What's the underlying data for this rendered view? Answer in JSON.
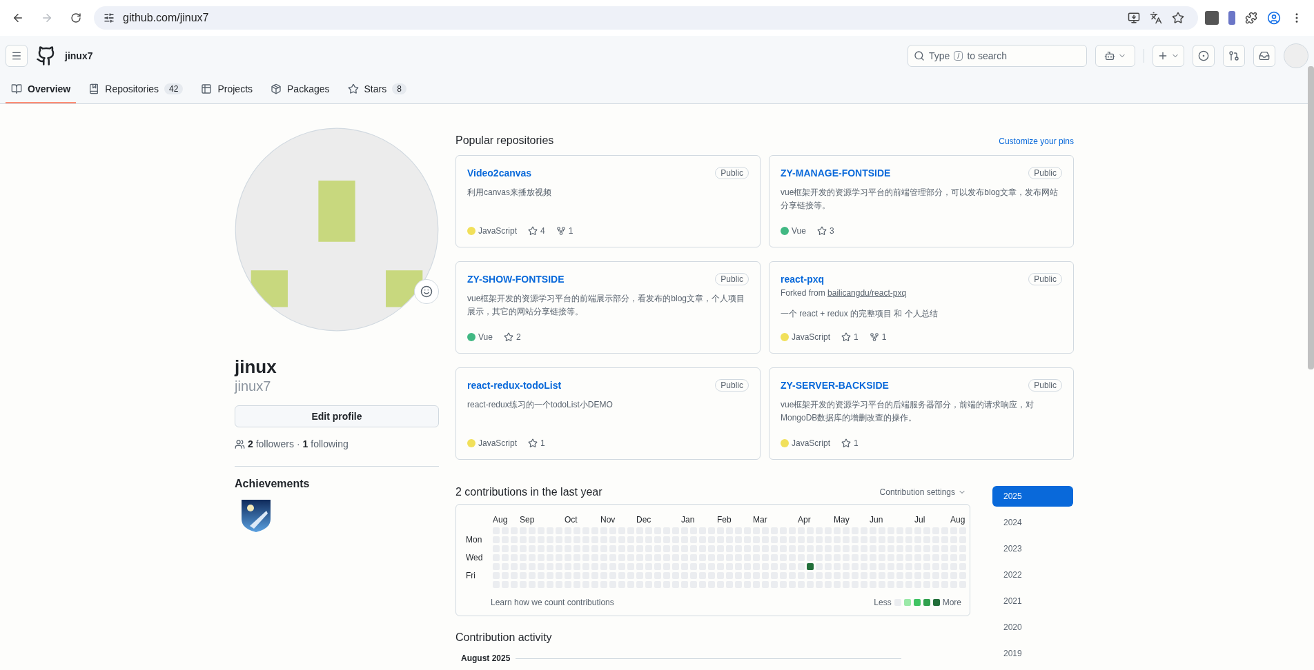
{
  "browser": {
    "url": "github.com/jinux7",
    "can_go_forward": false
  },
  "header": {
    "username": "jinux7",
    "search": {
      "prefix": "Type",
      "key": "/",
      "suffix": "to search"
    }
  },
  "tabs": [
    {
      "label": "Overview",
      "selected": true
    },
    {
      "label": "Repositories",
      "count": "42",
      "selected": false
    },
    {
      "label": "Projects",
      "selected": false
    },
    {
      "label": "Packages",
      "selected": false
    },
    {
      "label": "Stars",
      "count": "8",
      "selected": false
    }
  ],
  "profile": {
    "name": "jinux",
    "login": "jinux7",
    "edit_button": "Edit profile",
    "followers_count": "2",
    "followers_label": "followers",
    "separator": "·",
    "following_count": "1",
    "following_label": "following",
    "achievements_title": "Achievements"
  },
  "popular": {
    "heading": "Popular repositories",
    "customize_link": "Customize your pins",
    "repos": [
      {
        "name": "Video2canvas",
        "visibility": "Public",
        "description": "利用canvas来播放视频",
        "language": "JavaScript",
        "color": "#f1e05a",
        "stars": "4",
        "forks": "1"
      },
      {
        "name": "ZY-MANAGE-FONTSIDE",
        "visibility": "Public",
        "description": "vue框架开发的资源学习平台的前端管理部分，可以发布blog文章，发布网站分享链接等。",
        "language": "Vue",
        "color": "#41b883",
        "stars": "3"
      },
      {
        "name": "ZY-SHOW-FONTSIDE",
        "visibility": "Public",
        "description": "vue框架开发的资源学习平台的前端展示部分，看发布的blog文章，个人项目展示，其它的网站分享链接等。",
        "language": "Vue",
        "color": "#41b883",
        "stars": "2"
      },
      {
        "name": "react-pxq",
        "visibility": "Public",
        "forked_prefix": "Forked from",
        "forked_from": "bailicangdu/react-pxq",
        "description": "一个 react + redux 的完整项目 和 个人总结",
        "language": "JavaScript",
        "color": "#f1e05a",
        "stars": "1",
        "forks": "1"
      },
      {
        "name": "react-redux-todoList",
        "visibility": "Public",
        "description": "react-redux练习的一个todoList小DEMO",
        "language": "JavaScript",
        "color": "#f1e05a",
        "stars": "1"
      },
      {
        "name": "ZY-SERVER-BACKSIDE",
        "visibility": "Public",
        "description": "vue框架开发的资源学习平台的后端服务器部分，前端的请求响应，对MongoDB数据库的增删改查的操作。",
        "language": "JavaScript",
        "color": "#f1e05a",
        "stars": "1"
      }
    ]
  },
  "contributions": {
    "heading": "2 contributions in the last year",
    "settings": "Contribution settings",
    "months": [
      "Aug",
      "Sep",
      "Oct",
      "Nov",
      "Dec",
      "Jan",
      "Feb",
      "Mar",
      "Apr",
      "May",
      "Jun",
      "Jul",
      "Aug"
    ],
    "days": [
      "Mon",
      "Wed",
      "Fri"
    ],
    "active_cells": [
      {
        "color": "#216e39"
      }
    ],
    "learn_link": "Learn how we count contributions",
    "less": "Less",
    "more": "More",
    "legend": [
      {
        "color": "#ebedf0"
      },
      {
        "color": "#9be9a8"
      },
      {
        "color": "#40c463"
      },
      {
        "color": "#30a14e"
      },
      {
        "color": "#216e39"
      }
    ]
  },
  "years": [
    {
      "label": "2025",
      "selected": true
    },
    {
      "label": "2024",
      "selected": false
    },
    {
      "label": "2023",
      "selected": false
    },
    {
      "label": "2022",
      "selected": false
    },
    {
      "label": "2021",
      "selected": false
    },
    {
      "label": "2020",
      "selected": false
    },
    {
      "label": "2019",
      "selected": false
    }
  ],
  "activity": {
    "heading": "Contribution activity",
    "month": "August 2025"
  }
}
